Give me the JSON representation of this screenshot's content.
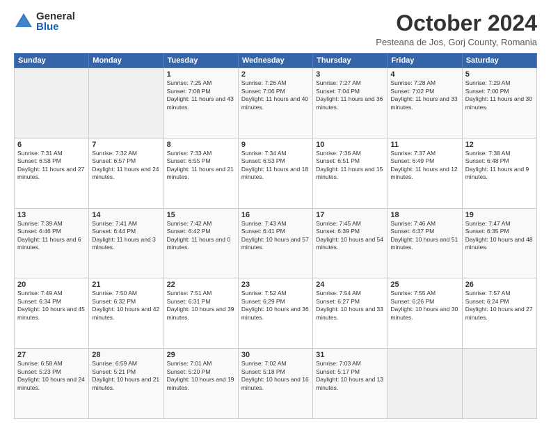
{
  "logo": {
    "general": "General",
    "blue": "Blue"
  },
  "header": {
    "month": "October 2024",
    "location": "Pesteana de Jos, Gorj County, Romania"
  },
  "weekdays": [
    "Sunday",
    "Monday",
    "Tuesday",
    "Wednesday",
    "Thursday",
    "Friday",
    "Saturday"
  ],
  "weeks": [
    [
      {
        "day": "",
        "info": ""
      },
      {
        "day": "",
        "info": ""
      },
      {
        "day": "1",
        "info": "Sunrise: 7:25 AM\nSunset: 7:08 PM\nDaylight: 11 hours and 43 minutes."
      },
      {
        "day": "2",
        "info": "Sunrise: 7:26 AM\nSunset: 7:06 PM\nDaylight: 11 hours and 40 minutes."
      },
      {
        "day": "3",
        "info": "Sunrise: 7:27 AM\nSunset: 7:04 PM\nDaylight: 11 hours and 36 minutes."
      },
      {
        "day": "4",
        "info": "Sunrise: 7:28 AM\nSunset: 7:02 PM\nDaylight: 11 hours and 33 minutes."
      },
      {
        "day": "5",
        "info": "Sunrise: 7:29 AM\nSunset: 7:00 PM\nDaylight: 11 hours and 30 minutes."
      }
    ],
    [
      {
        "day": "6",
        "info": "Sunrise: 7:31 AM\nSunset: 6:58 PM\nDaylight: 11 hours and 27 minutes."
      },
      {
        "day": "7",
        "info": "Sunrise: 7:32 AM\nSunset: 6:57 PM\nDaylight: 11 hours and 24 minutes."
      },
      {
        "day": "8",
        "info": "Sunrise: 7:33 AM\nSunset: 6:55 PM\nDaylight: 11 hours and 21 minutes."
      },
      {
        "day": "9",
        "info": "Sunrise: 7:34 AM\nSunset: 6:53 PM\nDaylight: 11 hours and 18 minutes."
      },
      {
        "day": "10",
        "info": "Sunrise: 7:36 AM\nSunset: 6:51 PM\nDaylight: 11 hours and 15 minutes."
      },
      {
        "day": "11",
        "info": "Sunrise: 7:37 AM\nSunset: 6:49 PM\nDaylight: 11 hours and 12 minutes."
      },
      {
        "day": "12",
        "info": "Sunrise: 7:38 AM\nSunset: 6:48 PM\nDaylight: 11 hours and 9 minutes."
      }
    ],
    [
      {
        "day": "13",
        "info": "Sunrise: 7:39 AM\nSunset: 6:46 PM\nDaylight: 11 hours and 6 minutes."
      },
      {
        "day": "14",
        "info": "Sunrise: 7:41 AM\nSunset: 6:44 PM\nDaylight: 11 hours and 3 minutes."
      },
      {
        "day": "15",
        "info": "Sunrise: 7:42 AM\nSunset: 6:42 PM\nDaylight: 11 hours and 0 minutes."
      },
      {
        "day": "16",
        "info": "Sunrise: 7:43 AM\nSunset: 6:41 PM\nDaylight: 10 hours and 57 minutes."
      },
      {
        "day": "17",
        "info": "Sunrise: 7:45 AM\nSunset: 6:39 PM\nDaylight: 10 hours and 54 minutes."
      },
      {
        "day": "18",
        "info": "Sunrise: 7:46 AM\nSunset: 6:37 PM\nDaylight: 10 hours and 51 minutes."
      },
      {
        "day": "19",
        "info": "Sunrise: 7:47 AM\nSunset: 6:35 PM\nDaylight: 10 hours and 48 minutes."
      }
    ],
    [
      {
        "day": "20",
        "info": "Sunrise: 7:49 AM\nSunset: 6:34 PM\nDaylight: 10 hours and 45 minutes."
      },
      {
        "day": "21",
        "info": "Sunrise: 7:50 AM\nSunset: 6:32 PM\nDaylight: 10 hours and 42 minutes."
      },
      {
        "day": "22",
        "info": "Sunrise: 7:51 AM\nSunset: 6:31 PM\nDaylight: 10 hours and 39 minutes."
      },
      {
        "day": "23",
        "info": "Sunrise: 7:52 AM\nSunset: 6:29 PM\nDaylight: 10 hours and 36 minutes."
      },
      {
        "day": "24",
        "info": "Sunrise: 7:54 AM\nSunset: 6:27 PM\nDaylight: 10 hours and 33 minutes."
      },
      {
        "day": "25",
        "info": "Sunrise: 7:55 AM\nSunset: 6:26 PM\nDaylight: 10 hours and 30 minutes."
      },
      {
        "day": "26",
        "info": "Sunrise: 7:57 AM\nSunset: 6:24 PM\nDaylight: 10 hours and 27 minutes."
      }
    ],
    [
      {
        "day": "27",
        "info": "Sunrise: 6:58 AM\nSunset: 5:23 PM\nDaylight: 10 hours and 24 minutes."
      },
      {
        "day": "28",
        "info": "Sunrise: 6:59 AM\nSunset: 5:21 PM\nDaylight: 10 hours and 21 minutes."
      },
      {
        "day": "29",
        "info": "Sunrise: 7:01 AM\nSunset: 5:20 PM\nDaylight: 10 hours and 19 minutes."
      },
      {
        "day": "30",
        "info": "Sunrise: 7:02 AM\nSunset: 5:18 PM\nDaylight: 10 hours and 16 minutes."
      },
      {
        "day": "31",
        "info": "Sunrise: 7:03 AM\nSunset: 5:17 PM\nDaylight: 10 hours and 13 minutes."
      },
      {
        "day": "",
        "info": ""
      },
      {
        "day": "",
        "info": ""
      }
    ]
  ]
}
